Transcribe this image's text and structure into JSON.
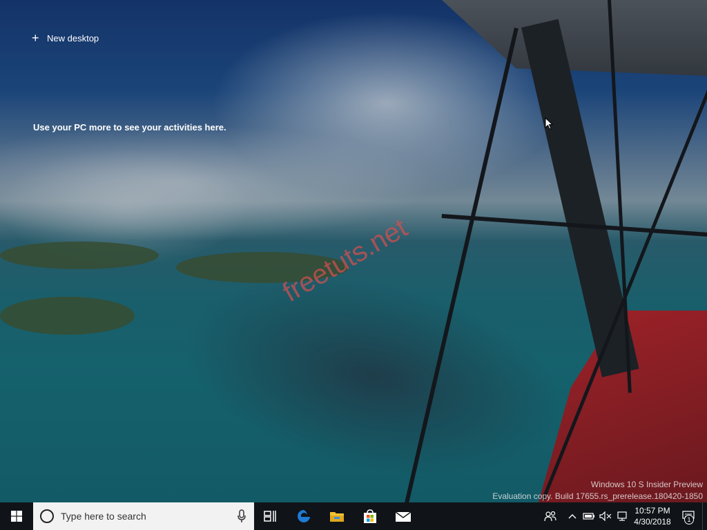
{
  "timeline": {
    "new_desktop_label": "New desktop",
    "empty_message": "Use your PC more to see your activities here."
  },
  "watermark": {
    "text": "freetuts.net"
  },
  "evaluation": {
    "line1": "Windows 10 S Insider Preview",
    "line2": "Evaluation copy. Build 17655.rs_prerelease.180420-1850"
  },
  "taskbar": {
    "search_placeholder": "Type here to search",
    "pinned": [
      {
        "name": "task-view-icon"
      },
      {
        "name": "edge-icon",
        "color": "#1e7bd6"
      },
      {
        "name": "file-explorer-icon",
        "color": "#f2c231"
      },
      {
        "name": "store-icon"
      },
      {
        "name": "mail-icon"
      }
    ],
    "clock": {
      "time": "10:57 PM",
      "date": "4/30/2018"
    },
    "notifications_count": "1"
  }
}
